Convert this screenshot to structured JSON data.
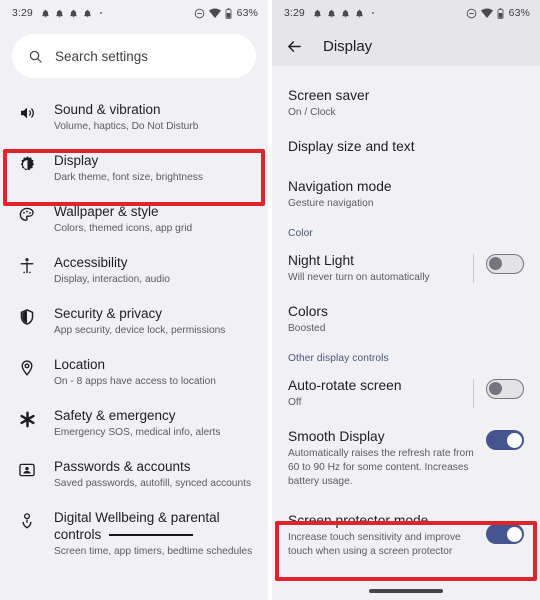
{
  "left": {
    "status_bar": {
      "time": "3:29",
      "notification_icons": [
        "bell-icon",
        "bell-icon",
        "bell-icon",
        "bell-icon"
      ],
      "overflow_dot": "•",
      "dnd_icon": "do-not-disturb-icon",
      "wifi_icon": "wifi-icon",
      "battery_icon": "battery-icon",
      "battery_percent": "63%"
    },
    "search": {
      "icon": "search-icon",
      "placeholder": "Search settings"
    },
    "items": [
      {
        "icon": "sound-icon",
        "title": "Sound & vibration",
        "sub": "Volume, haptics, Do Not Disturb"
      },
      {
        "icon": "brightness-icon",
        "title": "Display",
        "sub": "Dark theme, font size, brightness"
      },
      {
        "icon": "palette-icon",
        "title": "Wallpaper & style",
        "sub": "Colors, themed icons, app grid"
      },
      {
        "icon": "accessibility-icon",
        "title": "Accessibility",
        "sub": "Display, interaction, audio"
      },
      {
        "icon": "shield-icon",
        "title": "Security & privacy",
        "sub": "App security, device lock, permissions"
      },
      {
        "icon": "location-pin-icon",
        "title": "Location",
        "sub": "On - 8 apps have access to location"
      },
      {
        "icon": "asterisk-icon",
        "title": "Safety & emergency",
        "sub": "Emergency SOS, medical info, alerts"
      },
      {
        "icon": "account-card-icon",
        "title": "Passwords & accounts",
        "sub": "Saved passwords, autofill, synced accounts"
      },
      {
        "icon": "wellbeing-icon",
        "title": "Digital Wellbeing & parental controls",
        "sub": "Screen time, app timers, bedtime schedules"
      }
    ],
    "highlight_target": "Display"
  },
  "right": {
    "status_bar": {
      "time": "3:29",
      "notification_icons": [
        "bell-icon",
        "bell-icon",
        "bell-icon",
        "bell-icon"
      ],
      "overflow_dot": "•",
      "dnd_icon": "do-not-disturb-icon",
      "wifi_icon": "wifi-icon",
      "battery_icon": "battery-icon",
      "battery_percent": "63%"
    },
    "toolbar": {
      "back_icon": "arrow-back-icon",
      "title": "Display"
    },
    "rows": [
      {
        "title": "Screen saver",
        "sub": "On / Clock",
        "toggle": null
      },
      {
        "title": "Display size and text",
        "sub": "",
        "toggle": null
      },
      {
        "title": "Navigation mode",
        "sub": "Gesture navigation",
        "toggle": null
      }
    ],
    "section_color": "Color",
    "color_rows": [
      {
        "title": "Night Light",
        "sub": "Will never turn on automatically",
        "toggle": "off"
      },
      {
        "title": "Colors",
        "sub": "Boosted",
        "toggle": null
      }
    ],
    "section_other": "Other display controls",
    "other_rows": [
      {
        "title": "Auto-rotate screen",
        "sub": "Off",
        "toggle": "off"
      },
      {
        "title": "Smooth Display",
        "sub": "Automatically raises the refresh rate from 60 to 90 Hz for some content. Increases battery usage.",
        "toggle": "on"
      },
      {
        "title": "Screen protector mode",
        "sub": "Increase touch sensitivity and improve touch when using a screen protector",
        "toggle": "on"
      }
    ],
    "highlight_target": "Screen protector mode"
  },
  "colors": {
    "highlight_red": "#e1232b",
    "toggle_on": "#44558f",
    "toggle_off_track": "#e3e2e7",
    "panel_bg": "#f1f0f5",
    "header_bg": "#e6e5ea",
    "section_label": "#4a5578"
  }
}
